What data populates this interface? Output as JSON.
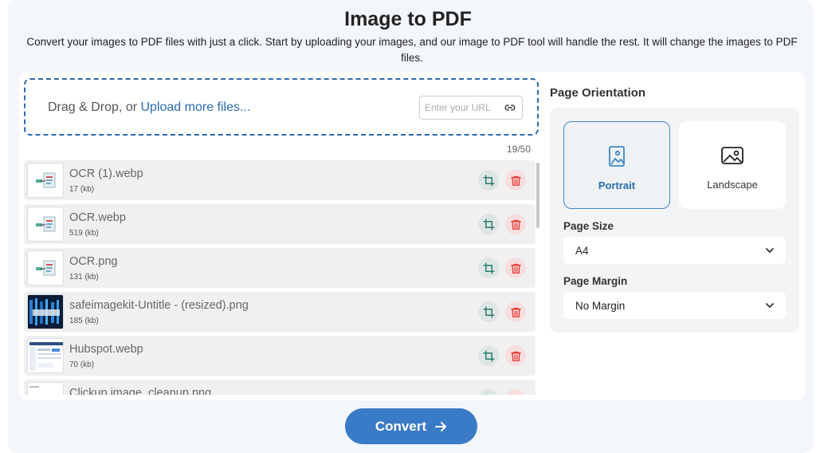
{
  "header": {
    "title": "Image to PDF",
    "subtitle": "Convert your images to PDF files with just a click. Start by uploading your images, and our image to PDF tool will handle the rest. It will change the images to PDF files."
  },
  "upload": {
    "prefix": "Drag & Drop, or ",
    "link": "Upload more files...",
    "url_placeholder": "Enter your URL",
    "counter": "19/50"
  },
  "files": [
    {
      "name": "OCR (1).webp",
      "size": "17 (kb)",
      "thumb": "ocr"
    },
    {
      "name": "OCR.webp",
      "size": "519 (kb)",
      "thumb": "ocr"
    },
    {
      "name": "OCR.png",
      "size": "131 (kb)",
      "thumb": "ocr"
    },
    {
      "name": "safeimagekit-Untitle - (resized).png",
      "size": "185 (kb)",
      "thumb": "dark"
    },
    {
      "name": "Hubspot.webp",
      "size": "70 (kb)",
      "thumb": "web"
    },
    {
      "name": "Clickup image_cleanup.png",
      "size": "",
      "thumb": "web"
    }
  ],
  "settings": {
    "orientation_title": "Page Orientation",
    "portrait": "Portrait",
    "landscape": "Landscape",
    "page_size_label": "Page Size",
    "page_size_value": "A4",
    "page_margin_label": "Page Margin",
    "page_margin_value": "No Margin"
  },
  "actions": {
    "convert": "Convert"
  },
  "colors": {
    "accent": "#3a7bc8",
    "delete": "#e53935",
    "crop": "#2e7d6b"
  }
}
